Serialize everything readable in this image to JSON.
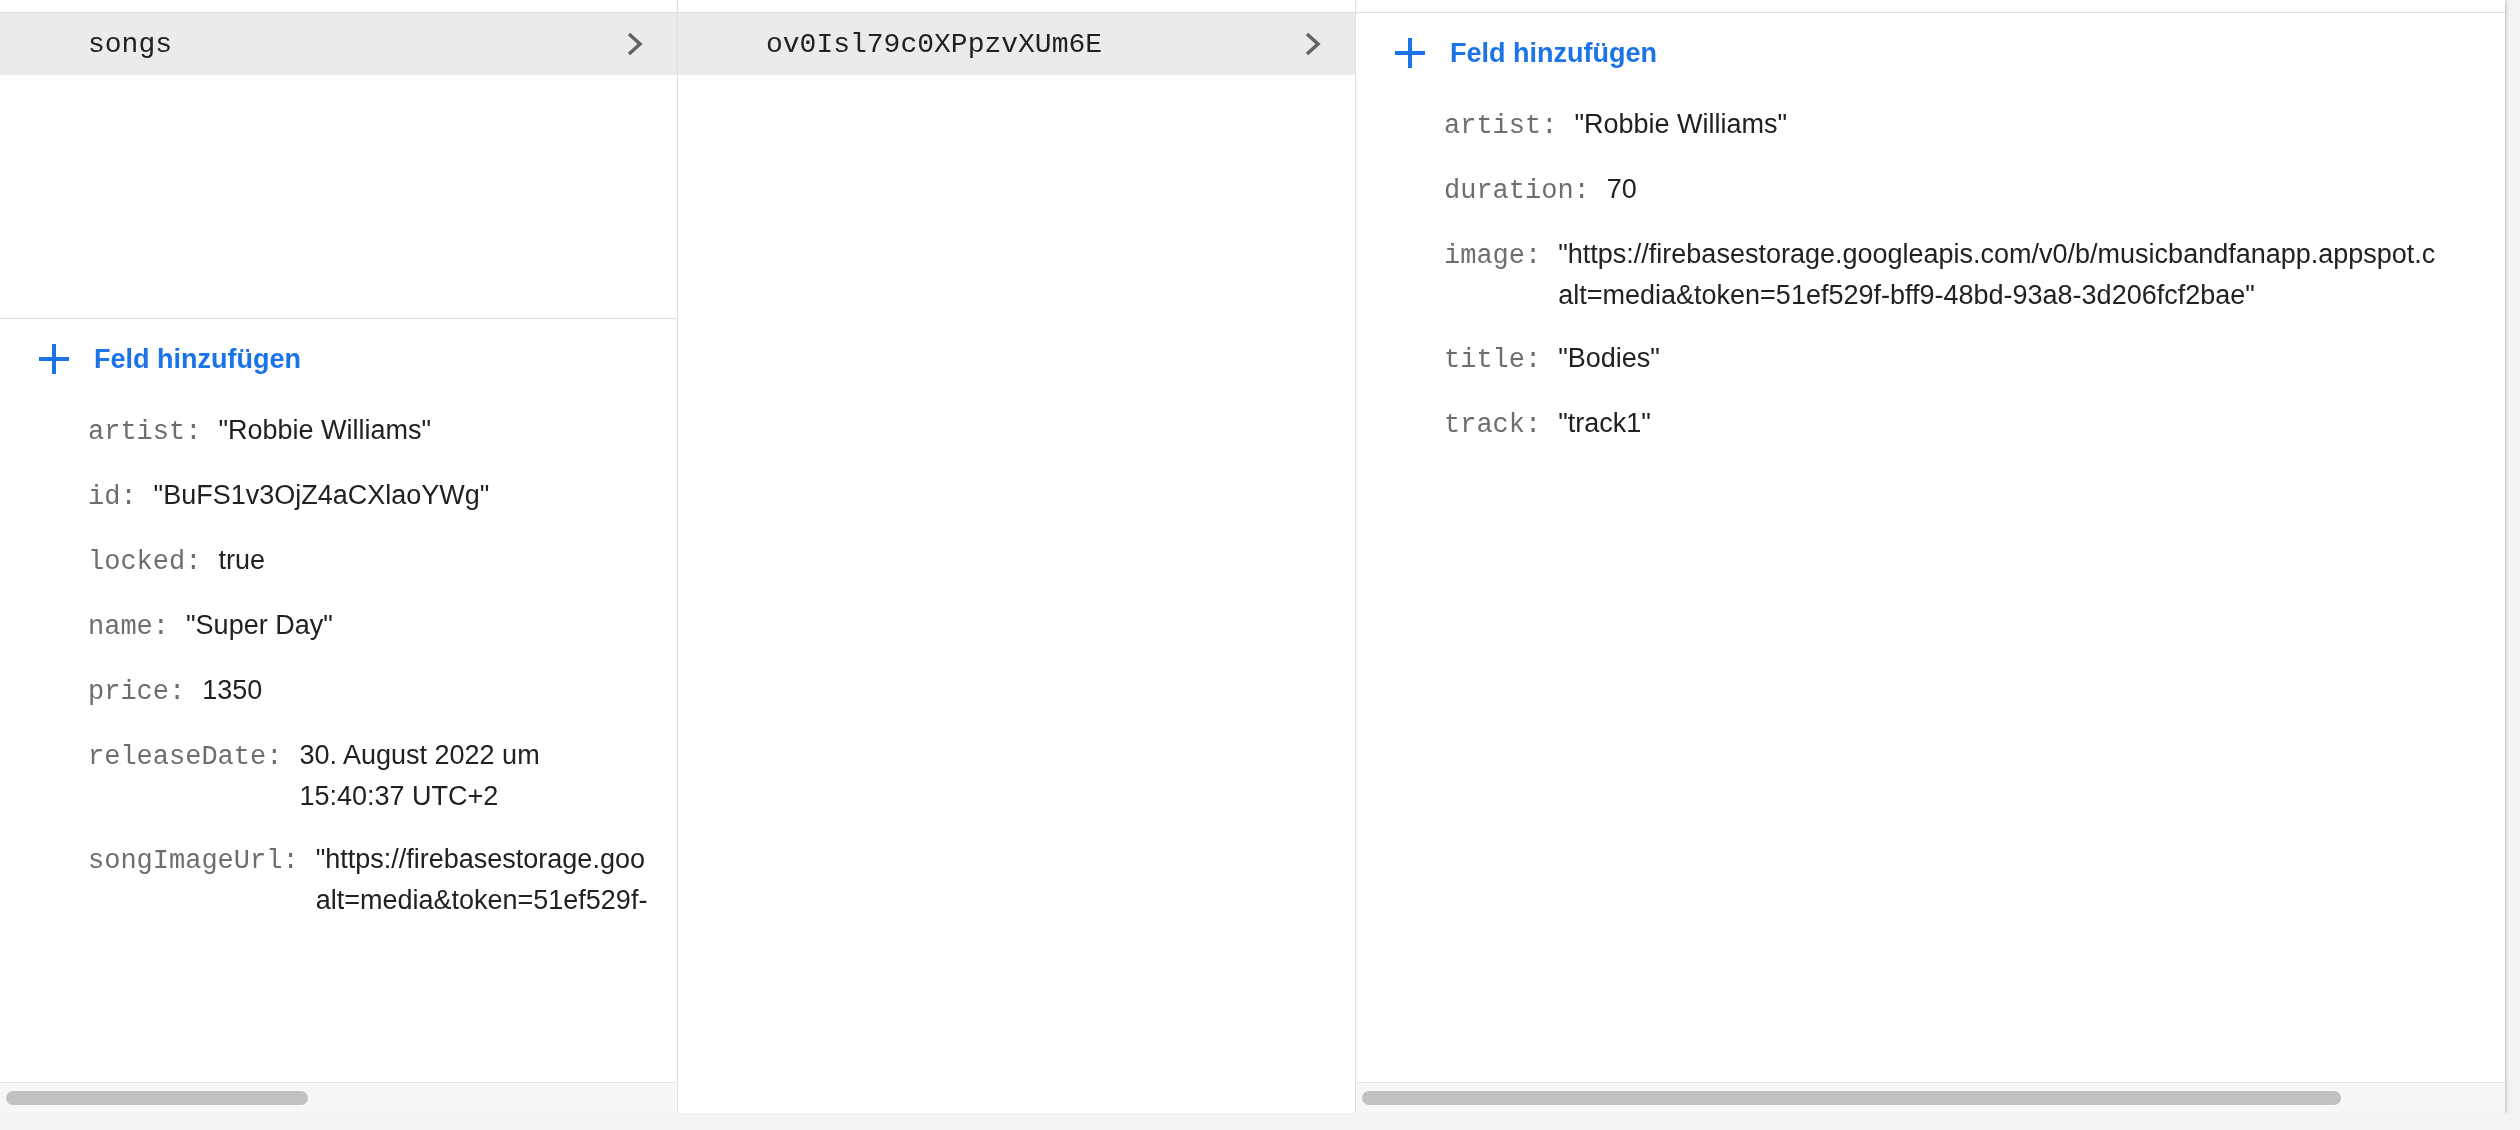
{
  "columns": [
    {
      "items": [
        {
          "label": "songs",
          "selected": true
        }
      ],
      "add_field": "Feld hinzufügen",
      "fields": [
        {
          "key": "artist:",
          "lines": [
            "\"Robbie Williams\""
          ]
        },
        {
          "key": "id:",
          "lines": [
            "\"BuFS1v3OjZ4aCXlaoYWg\""
          ]
        },
        {
          "key": "locked:",
          "lines": [
            "true"
          ]
        },
        {
          "key": "name:",
          "lines": [
            "\"Super Day\""
          ]
        },
        {
          "key": "price:",
          "lines": [
            "1350"
          ]
        },
        {
          "key": "releaseDate:",
          "lines": [
            "30. August 2022 um",
            "15:40:37 UTC+2"
          ]
        },
        {
          "key": "songImageUrl:",
          "lines": [
            "\"https://firebasestorage.goo",
            "alt=media&token=51ef529f-"
          ]
        }
      ]
    },
    {
      "items": [
        {
          "label": "ov0Isl79c0XPpzvXUm6E",
          "selected": true
        }
      ]
    },
    {
      "add_field": "Feld hinzufügen",
      "fields": [
        {
          "key": "artist:",
          "lines": [
            "\"Robbie Williams\""
          ]
        },
        {
          "key": "duration:",
          "lines": [
            "70"
          ]
        },
        {
          "key": "image:",
          "lines": [
            "\"https://firebasestorage.googleapis.com/v0/b/musicbandfanapp.appspot.c",
            "alt=media&token=51ef529f-bff9-48bd-93a8-3d206fcf2bae\""
          ]
        },
        {
          "key": "title:",
          "lines": [
            "\"Bodies\""
          ]
        },
        {
          "key": "track:",
          "lines": [
            "\"track1\""
          ]
        }
      ]
    }
  ]
}
